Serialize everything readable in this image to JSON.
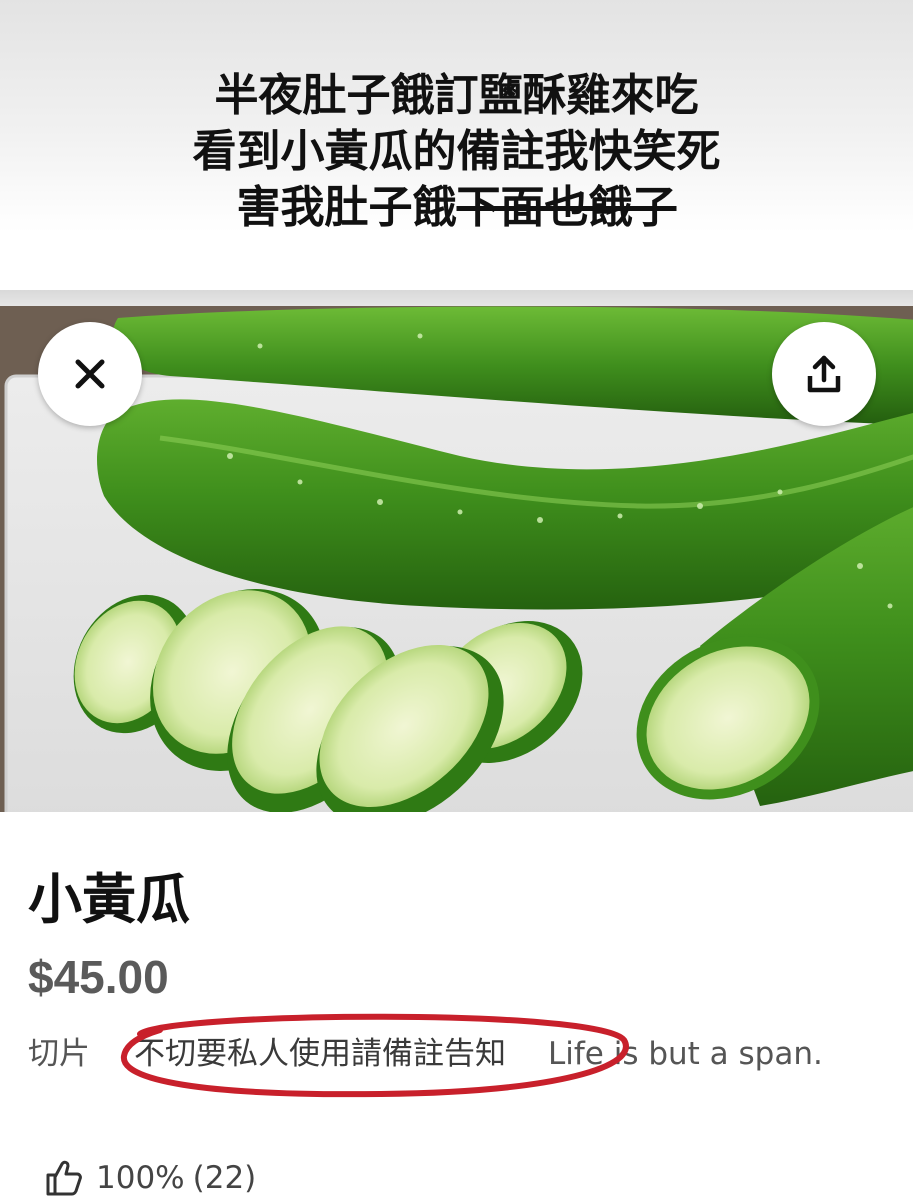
{
  "caption": {
    "line1": "半夜肚子餓訂鹽酥雞來吃",
    "line2": "看到小黃瓜的備註我快笑死",
    "line3_plain": "害我肚子餓",
    "line3_struck": "下面也餓了"
  },
  "hero": {
    "close_icon": "close-icon",
    "share_icon": "share-icon"
  },
  "product": {
    "name": "小黃瓜",
    "price": "$45.00",
    "description": {
      "part1": "切片",
      "part2_circled": "不切要私人使用請備註告知",
      "part3": "Life is but a span."
    },
    "rating": {
      "icon": "thumbs-up-icon",
      "percent": "100%",
      "count": "(22)"
    }
  },
  "colors": {
    "annotation_circle": "#c8202b",
    "price_text": "#5a5a5a",
    "description_text": "#555555"
  }
}
